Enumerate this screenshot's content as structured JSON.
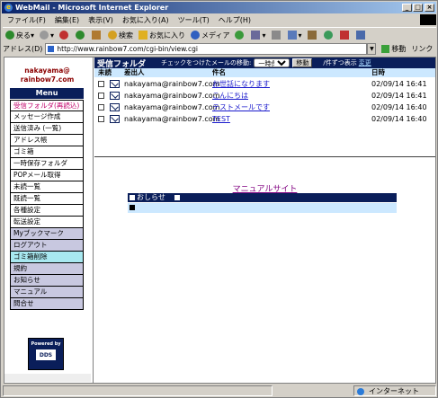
{
  "window": {
    "title": "WebMail - Microsoft Internet Explorer"
  },
  "menubar": [
    "ファイル(F)",
    "編集(E)",
    "表示(V)",
    "お気に入り(A)",
    "ツール(T)",
    "ヘルプ(H)"
  ],
  "toolbar": {
    "back": "戻る",
    "search": "検索",
    "favorites": "お気に入り",
    "media": "メディア"
  },
  "address": {
    "label": "アドレス(D)",
    "url": "http://www.rainbow7.com/cgi-bin/view.cgi",
    "go": "移動",
    "links": "リンク"
  },
  "sidebar": {
    "user_line1": "nakayama@",
    "user_line2": "rainbow7.com",
    "menu_title": "Menu",
    "items": [
      {
        "label": "受信フォルダ(再読込)",
        "style": "sel"
      },
      {
        "label": "メッセージ作成",
        "style": ""
      },
      {
        "label": "送信済み (一覧)",
        "style": ""
      },
      {
        "label": "アドレス帳",
        "style": ""
      },
      {
        "label": "ゴミ箱",
        "style": ""
      },
      {
        "label": "一時保存フォルダ",
        "style": ""
      },
      {
        "label": "POPメール取得",
        "style": ""
      },
      {
        "label": "未読一覧",
        "style": ""
      },
      {
        "label": "既読一覧",
        "style": ""
      },
      {
        "label": "各種設定",
        "style": ""
      },
      {
        "label": "転送設定",
        "style": ""
      },
      {
        "label": "Myブックマーク",
        "style": "gray"
      },
      {
        "label": "ログアウト",
        "style": "gray"
      },
      {
        "label": "ゴミ箱削除",
        "style": "cyan"
      },
      {
        "label": "規約",
        "style": "gray"
      },
      {
        "label": "お知らせ",
        "style": "gray"
      },
      {
        "label": "マニュアル",
        "style": "gray"
      },
      {
        "label": "問合せ",
        "style": "gray"
      }
    ],
    "powered_by": "Powered by",
    "powered_logo": "DDS"
  },
  "folder": {
    "title": "受信フォルダ",
    "move_label": "チェックをつけたメールの移動:",
    "move_select": "一時保存",
    "move_button": "移動",
    "per_page": "/件ずつ表示",
    "change": "変更",
    "columns": {
      "unread": "未読",
      "from": "差出人",
      "subject": "件名",
      "date": "日時"
    },
    "messages": [
      {
        "from": "nakayama@rainbow7.com",
        "subject": "お世話になります",
        "date": "02/09/14 16:41"
      },
      {
        "from": "nakayama@rainbow7.com",
        "subject": "こんにちは",
        "date": "02/09/14 16:41"
      },
      {
        "from": "nakayama@rainbow7.com",
        "subject": "テストメールです",
        "date": "02/09/14 16:40"
      },
      {
        "from": "nakayama@rainbow7.com",
        "subject": "TEST",
        "date": "02/09/14 16:40"
      }
    ]
  },
  "manual_link": "マニュアルサイト",
  "news": {
    "title": "おしらせ"
  },
  "statusbar": {
    "zone": "インターネット"
  }
}
